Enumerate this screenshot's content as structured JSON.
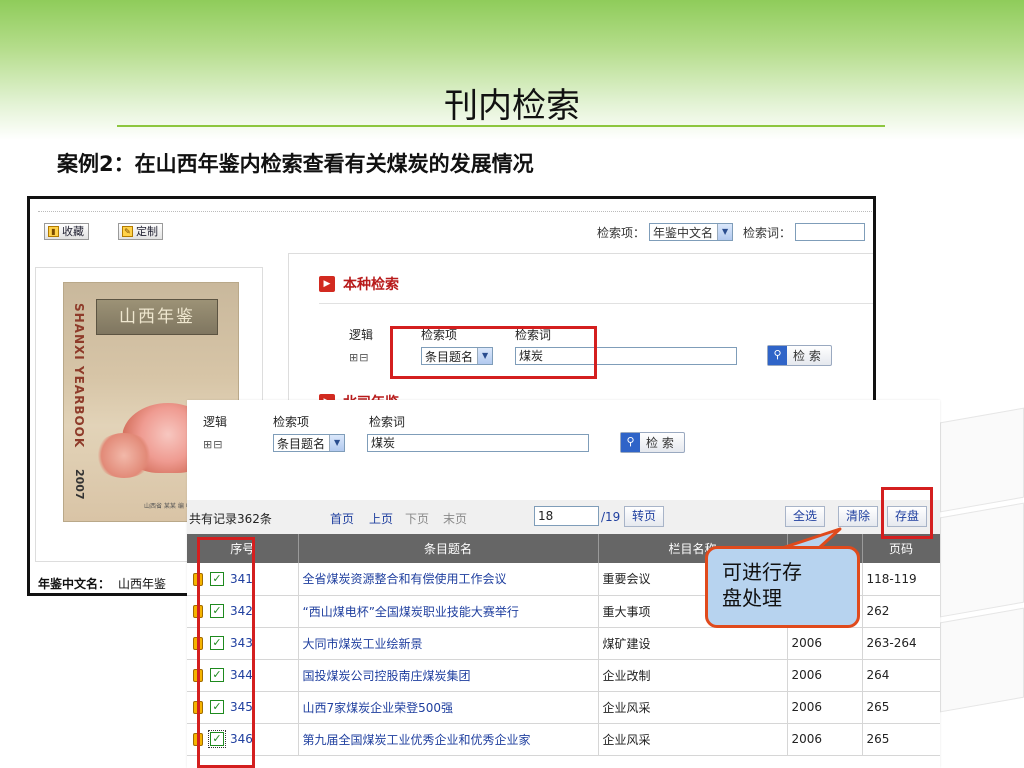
{
  "slide": {
    "title": "刊内检索",
    "case_text": "案例2：在山西年鉴内检索查看有关煤炭的发展情况"
  },
  "back_window": {
    "toolbar": {
      "favorite_label": "收藏",
      "customize_label": "定制"
    },
    "top_search": {
      "field_label": "检索项：",
      "field_value": "年鉴中文名",
      "word_label": "检索词："
    },
    "cover": {
      "banner_text": "山西年鉴",
      "vertical_text": "SHANXI YEARBOOK",
      "year": "2007",
      "publisher": "山西省 某某 编 中国文史出版社"
    },
    "name_label": "年鉴中文名：",
    "name_value": "山西年鉴",
    "section_this": "本种检索",
    "section_cut": "北司年鉴",
    "logic_label": "逻辑",
    "field_label": "检索项",
    "word_label": "检索词",
    "plus_minus": "⊞⊟",
    "field_value": "条目题名",
    "word_value": "煤炭",
    "search_button": "检 索"
  },
  "front": {
    "logic_label": "逻辑",
    "field_label": "检索项",
    "word_label": "检索词",
    "plus_minus": "⊞⊟",
    "field_value": "条目题名",
    "word_value": "煤炭",
    "search_button": "检 索",
    "pager": {
      "total": "共有记录362条",
      "first": "首页",
      "prev": "上页",
      "next": "下页",
      "last": "末页",
      "page_value": "18",
      "page_total": "/19",
      "goto": "转页",
      "select_all": "全选",
      "clear": "清除",
      "save": "存盘"
    },
    "table": {
      "headers": [
        "序号",
        "条目题名",
        "栏目名称",
        "",
        "页码"
      ],
      "rows": [
        {
          "seq": "341",
          "title": "全省煤炭资源整合和有偿使用工作会议",
          "column": "重要会议",
          "year": "",
          "page": "118-119"
        },
        {
          "seq": "342",
          "title": "“西山煤电杯”全国煤炭职业技能大赛举行",
          "column": "重大事项",
          "year": "",
          "page": "262"
        },
        {
          "seq": "343",
          "title": "大同市煤炭工业绘新景",
          "column": "煤矿建设",
          "year": "2006",
          "page": "263-264"
        },
        {
          "seq": "344",
          "title": "国投煤炭公司控股南庄煤炭集团",
          "column": "企业改制",
          "year": "2006",
          "page": "264"
        },
        {
          "seq": "345",
          "title": "山西7家煤炭企业荣登500强",
          "column": "企业风采",
          "year": "2006",
          "page": "265"
        },
        {
          "seq": "346",
          "title": "第九届全国煤炭工业优秀企业和优秀企业家",
          "column": "企业风采",
          "year": "2006",
          "page": "265"
        }
      ]
    }
  },
  "callout_text_1": "可进行存",
  "callout_text_2": "盘处理",
  "colors": {
    "accent_red": "#d41f1f",
    "header_gray": "#666666",
    "callout_bg": "#b7d3ef",
    "callout_border": "#e04a1c",
    "title_rule": "#8dc63f"
  }
}
